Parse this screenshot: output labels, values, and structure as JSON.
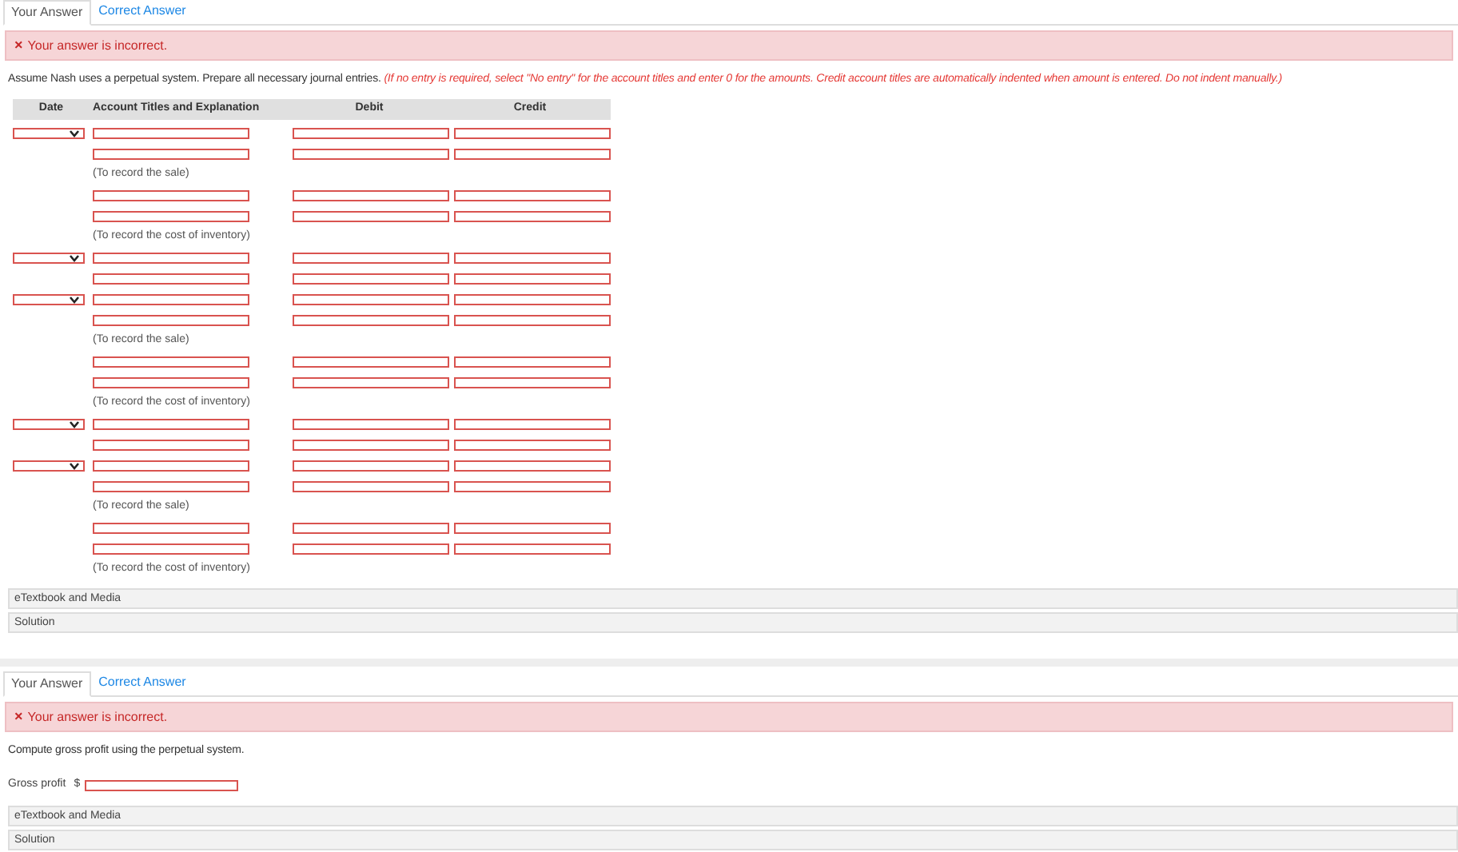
{
  "sections": [
    {
      "tabs": [
        {
          "label": "Your Answer",
          "selected": true
        },
        {
          "label": "Correct Answer",
          "selected": false
        }
      ],
      "alert": {
        "icon": "×",
        "message": "Your answer is incorrect."
      },
      "instruction": "Assume Nash uses a perpetual system. Prepare all necessary journal entries. ",
      "instruction_note": "(If no entry is required, select \"No entry\" for the account titles and enter 0 for the amounts. Credit account titles are automatically indented when amount is entered. Do not indent manually.)",
      "journal": {
        "columns": [
          "Date",
          "Account Titles and Explanation",
          "Debit",
          "Credit"
        ],
        "rows": [
          {
            "kind": "entry",
            "has_date": true
          },
          {
            "kind": "entry",
            "has_date": false
          },
          {
            "kind": "note",
            "text": "(To record the sale)"
          },
          {
            "kind": "entry",
            "has_date": false
          },
          {
            "kind": "entry",
            "has_date": false
          },
          {
            "kind": "note",
            "text": "(To record the cost of inventory)"
          },
          {
            "kind": "entry",
            "has_date": true
          },
          {
            "kind": "entry",
            "has_date": false
          },
          {
            "kind": "entry",
            "has_date": true
          },
          {
            "kind": "entry",
            "has_date": false
          },
          {
            "kind": "note",
            "text": "(To record the sale)"
          },
          {
            "kind": "entry",
            "has_date": false
          },
          {
            "kind": "entry",
            "has_date": false
          },
          {
            "kind": "note",
            "text": "(To record the cost of inventory)"
          },
          {
            "kind": "entry",
            "has_date": true
          },
          {
            "kind": "entry",
            "has_date": false
          },
          {
            "kind": "entry",
            "has_date": true
          },
          {
            "kind": "entry",
            "has_date": false
          },
          {
            "kind": "note",
            "text": "(To record the sale)"
          },
          {
            "kind": "entry",
            "has_date": false
          },
          {
            "kind": "entry",
            "has_date": false
          },
          {
            "kind": "note",
            "text": "(To record the cost of inventory)"
          }
        ]
      },
      "resources": [
        "eTextbook and Media",
        "Solution"
      ]
    },
    {
      "tabs": [
        {
          "label": "Your Answer",
          "selected": true
        },
        {
          "label": "Correct Answer",
          "selected": false
        }
      ],
      "alert": {
        "icon": "×",
        "message": "Your answer is incorrect."
      },
      "instruction": "Compute gross profit using the perpetual system.",
      "field": {
        "label": "Gross profit",
        "prefix": "$"
      },
      "resources": [
        "eTextbook and Media",
        "Solution"
      ]
    }
  ]
}
